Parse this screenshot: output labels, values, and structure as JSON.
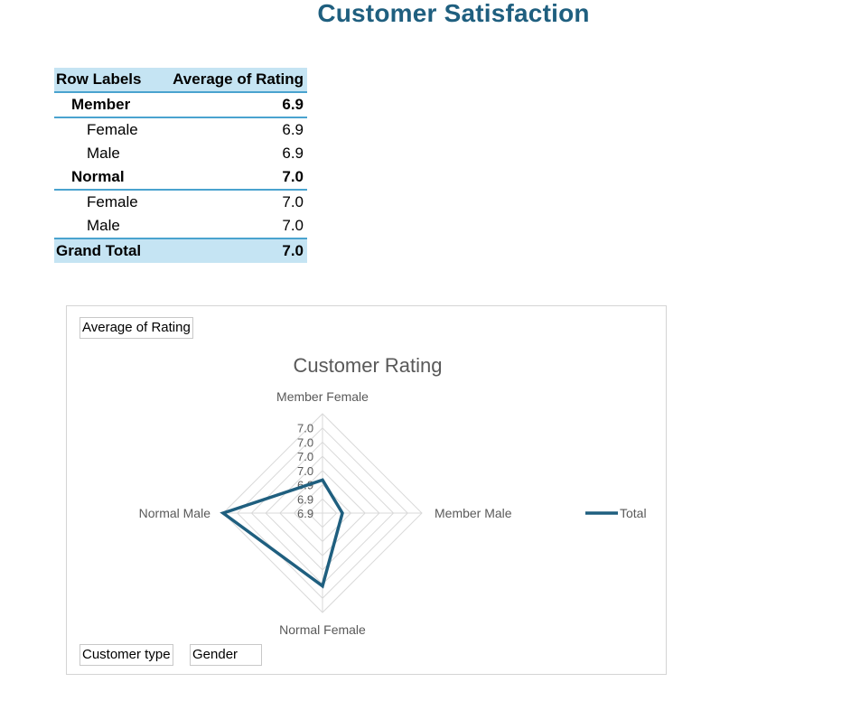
{
  "page": {
    "title": "Customer Satisfaction"
  },
  "pivot": {
    "header": {
      "label": "Row Labels",
      "value": "Average of Rating"
    },
    "rows": [
      {
        "type": "group",
        "label": "Member",
        "value": "6.9"
      },
      {
        "type": "child",
        "label": "Female",
        "value": "6.9"
      },
      {
        "type": "child",
        "label": "Male",
        "value": "6.9"
      },
      {
        "type": "group",
        "label": "Normal",
        "value": "7.0"
      },
      {
        "type": "child",
        "label": "Female",
        "value": "7.0"
      },
      {
        "type": "child",
        "label": "Male",
        "value": "7.0"
      }
    ],
    "total": {
      "label": "Grand Total",
      "value": "7.0"
    }
  },
  "chart_buttons": {
    "value_field": "Average of Rating",
    "axis_field_1": "Customer type",
    "axis_field_2": "Gender"
  },
  "chart_data": {
    "type": "radar",
    "title": "Customer Rating",
    "categories": [
      "Member Female",
      "Member Male",
      "Normal Female",
      "Normal Male"
    ],
    "axis_tick_labels": [
      "6.9",
      "6.9",
      "6.9",
      "7.0",
      "7.0",
      "7.0",
      "7.0"
    ],
    "axis_range": [
      6.88,
      7.03
    ],
    "series": [
      {
        "name": "Total",
        "values": [
          6.93,
          6.91,
          6.99,
          7.03
        ],
        "color": "#1f5f7f"
      }
    ],
    "legend_position": "right",
    "grid": true
  }
}
